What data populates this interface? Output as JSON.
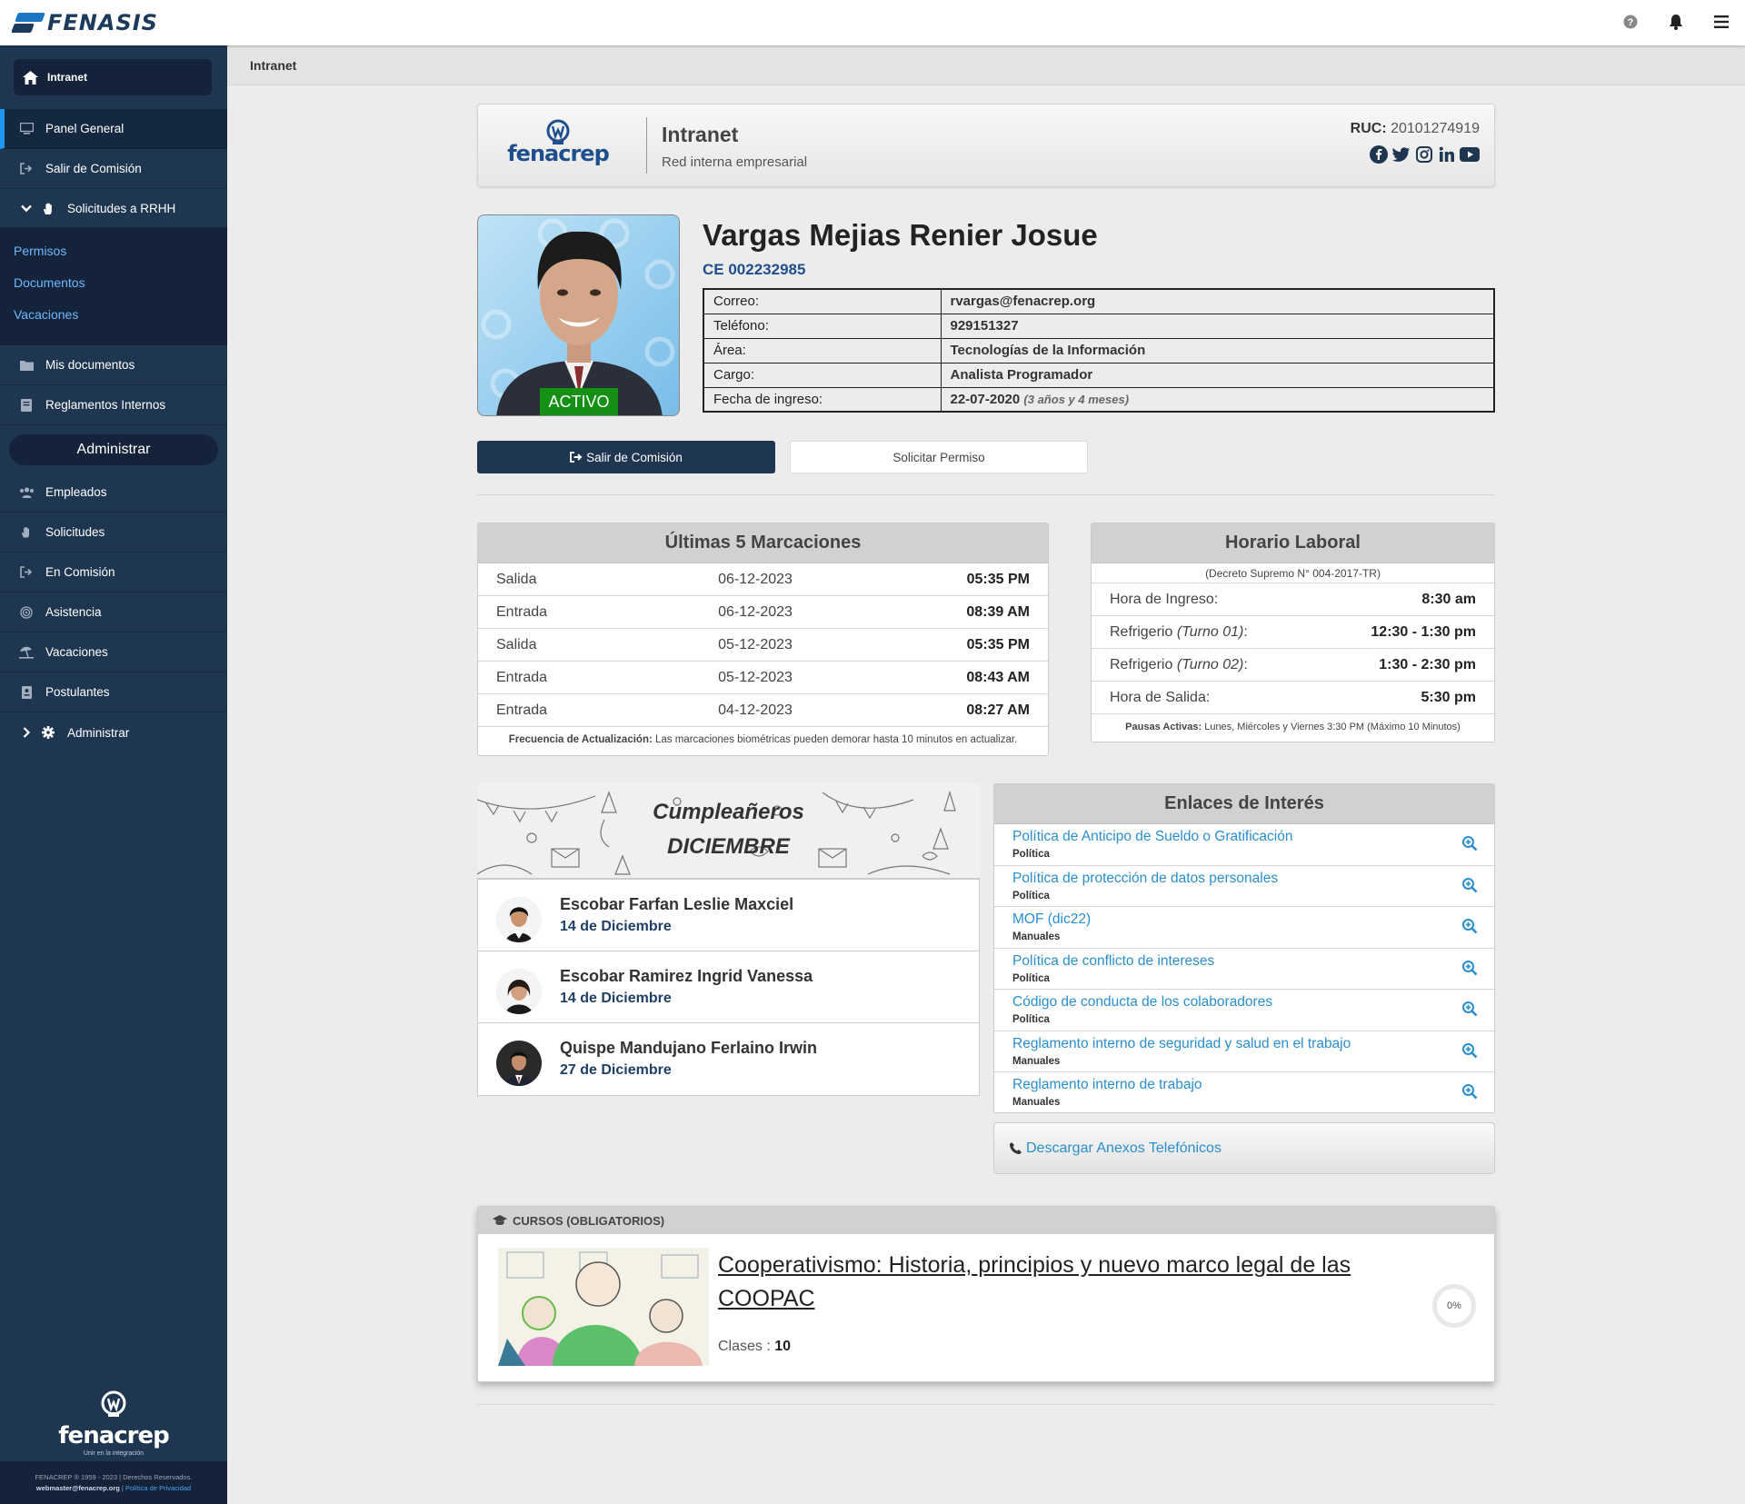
{
  "app": {
    "name": "FENASIS"
  },
  "breadcrumb": "Intranet",
  "sidebar": {
    "top_button": "Intranet",
    "items": [
      {
        "label": "Panel General",
        "icon": "monitor-icon"
      },
      {
        "label": "Salir de Comisión",
        "icon": "sign-out-icon"
      },
      {
        "label": "Solicitudes a RRHH",
        "icon": "hand-icon"
      },
      {
        "label": "Mis documentos",
        "icon": "folder-icon"
      },
      {
        "label": "Reglamentos Internos",
        "icon": "book-icon"
      }
    ],
    "submenu": [
      "Permisos",
      "Documentos",
      "Vacaciones"
    ],
    "admin_header": "Administrar",
    "admin_items": [
      {
        "label": "Empleados",
        "icon": "users-icon"
      },
      {
        "label": "Solicitudes",
        "icon": "hand-icon"
      },
      {
        "label": "En Comisión",
        "icon": "sign-out-icon"
      },
      {
        "label": "Asistencia",
        "icon": "fingerprint-icon"
      },
      {
        "label": "Vacaciones",
        "icon": "umbrella-beach-icon"
      },
      {
        "label": "Postulantes",
        "icon": "id-card-icon"
      },
      {
        "label": "Administrar",
        "icon": "gear-icon"
      }
    ],
    "logo_text": "fenacrep",
    "logo_tagline": "Unir en la integración",
    "footer_line1": "FENACREP ® 1959 - 2023 | Derechos Reservados.",
    "footer_email": "webmaster@fenacrep.org",
    "footer_sep": "|",
    "footer_privacy": "Política de Privacidad"
  },
  "header": {
    "logo_text": "fenacrep",
    "title": "Intranet",
    "subtitle": "Red interna empresarial",
    "ruc_label": "RUC:",
    "ruc_value": "20101274919"
  },
  "profile": {
    "status": "ACTIVO",
    "name": "Vargas Mejias Renier Josue",
    "id": "CE 002232985",
    "fields": [
      {
        "label": "Correo:",
        "value": "rvargas@fenacrep.org"
      },
      {
        "label": "Teléfono:",
        "value": "929151327"
      },
      {
        "label": "Área:",
        "value": "Tecnologías de la Información"
      },
      {
        "label": "Cargo:",
        "value": "Analista Programador"
      },
      {
        "label": "Fecha de ingreso:",
        "value": "22-07-2020",
        "extra": "(3 años y 4 meses)"
      }
    ]
  },
  "actions": {
    "primary": "Salir de Comisión",
    "secondary": "Solicitar Permiso"
  },
  "marcaciones": {
    "title": "Últimas 5 Marcaciones",
    "rows": [
      {
        "type": "Salida",
        "date": "06-12-2023",
        "time": "05:35 PM"
      },
      {
        "type": "Entrada",
        "date": "06-12-2023",
        "time": "08:39 AM"
      },
      {
        "type": "Salida",
        "date": "05-12-2023",
        "time": "05:35 PM"
      },
      {
        "type": "Entrada",
        "date": "05-12-2023",
        "time": "08:43 AM"
      },
      {
        "type": "Entrada",
        "date": "04-12-2023",
        "time": "08:27 AM"
      }
    ],
    "note_label": "Frecuencia de Actualización:",
    "note_text": "Las marcaciones biométricas pueden demorar hasta 10 minutos en actualizar."
  },
  "horario": {
    "title": "Horario Laboral",
    "decree": "(Decreto Supremo N° 004-2017-TR)",
    "rows": [
      {
        "label": "Hora de Ingreso:",
        "label_turno": "",
        "label_end": "",
        "value": "8:30 am"
      },
      {
        "label": "Refrigerio",
        "label_turno": "(Turno 01)",
        "label_end": ":",
        "value": "12:30 - 1:30 pm"
      },
      {
        "label": "Refrigerio",
        "label_turno": "(Turno 02)",
        "label_end": ":",
        "value": "1:30 - 2:30 pm"
      },
      {
        "label": "Hora de Salida:",
        "label_turno": "",
        "label_end": "",
        "value": "5:30 pm"
      }
    ],
    "note_label": "Pausas Activas:",
    "note_text": "Lunes, Miércoles y Viernes 3:30 PM (Máximo 10 Minutos)"
  },
  "cumpleanos": {
    "title": "Cumpleañeros",
    "month": "DICIEMBRE",
    "people": [
      {
        "name": "Escobar Farfan Leslie Maxciel",
        "date": "14 de Diciembre"
      },
      {
        "name": "Escobar Ramirez Ingrid Vanessa",
        "date": "14 de Diciembre"
      },
      {
        "name": "Quispe Mandujano Ferlaino Irwin",
        "date": "27 de Diciembre"
      }
    ]
  },
  "enlaces": {
    "title": "Enlaces de Interés",
    "items": [
      {
        "title": "Política de Anticipo de Sueldo o Gratificación",
        "category": "Política"
      },
      {
        "title": "Política de protección de datos personales",
        "category": "Política"
      },
      {
        "title": "MOF (dic22)",
        "category": "Manuales"
      },
      {
        "title": "Política de conflicto de intereses",
        "category": "Política"
      },
      {
        "title": "Código de conducta de los colaboradores",
        "category": "Política"
      },
      {
        "title": "Reglamento interno de seguridad y salud en el trabajo",
        "category": "Manuales"
      },
      {
        "title": "Reglamento interno de trabajo",
        "category": "Manuales"
      }
    ],
    "download": "Descargar Anexos Telefónicos"
  },
  "cursos": {
    "header": "CURSOS (OBLIGATORIOS)",
    "course_title": "Cooperativismo: Historia, principios y nuevo marco legal de las COOPAC",
    "classes_label": "Clases :",
    "classes_value": "10",
    "progress": "0%"
  },
  "colors": {
    "sidebar_bg": "#1f3651",
    "sidebar_dark": "#14233a",
    "accent_blue": "#2196f3",
    "link_blue": "#2a8ecf",
    "status_green": "#149014",
    "brand_navy": "#1f4e8c"
  }
}
